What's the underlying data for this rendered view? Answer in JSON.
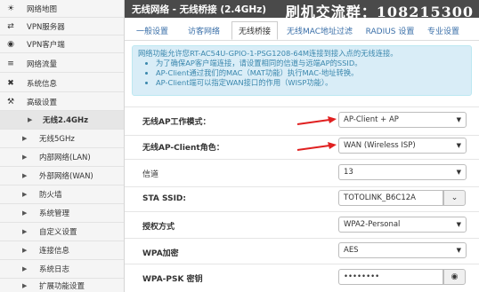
{
  "sidebar": {
    "items": [
      {
        "icon": "globe-icon",
        "glyph": "☀",
        "label": "网络地图"
      },
      {
        "icon": "vpn-server-icon",
        "glyph": "⇄",
        "label": "VPN服务器"
      },
      {
        "icon": "vpn-client-icon",
        "glyph": "◉",
        "label": "VPN客户端"
      },
      {
        "icon": "traffic-icon",
        "glyph": "≡",
        "label": "网络流量"
      },
      {
        "icon": "sysinfo-icon",
        "glyph": "✖",
        "label": "系统信息"
      },
      {
        "icon": "wrench-icon",
        "glyph": "⚒",
        "label": "高级设置"
      }
    ],
    "sub_items": [
      {
        "label": "无线2.4GHz",
        "active": true
      },
      {
        "label": "无线5GHz",
        "active": false
      },
      {
        "label": "内部网络(LAN)",
        "active": false
      },
      {
        "label": "外部网络(WAN)",
        "active": false
      },
      {
        "label": "防火墙",
        "active": false
      },
      {
        "label": "系统管理",
        "active": false
      },
      {
        "label": "自定义设置",
        "active": false
      },
      {
        "label": "连接信息",
        "active": false
      },
      {
        "label": "系统日志",
        "active": false
      },
      {
        "label": "扩展功能设置",
        "active": false
      }
    ]
  },
  "header": {
    "title": "无线网络 - 无线桥接 (2.4GHz)",
    "watermark": "刷机交流群：108215300"
  },
  "tabs": [
    {
      "label": "一般设置",
      "active": false
    },
    {
      "label": "访客网络",
      "active": false
    },
    {
      "label": "无线桥接",
      "active": true
    },
    {
      "label": "无线MAC地址过滤",
      "active": false
    },
    {
      "label": "RADIUS 设置",
      "active": false
    },
    {
      "label": "专业设置",
      "active": false
    }
  ],
  "info": {
    "intro": "网络功能允许您RT-AC54U-GPIO-1-PSG1208-64M连接到接入点的无线连接。",
    "bullets": [
      "为了确保AP客户端连接，请设置相同的信道与远端AP的SSID。",
      "AP-Client通过我们的MAC（MAT功能）执行MAC-地址转换。",
      "AP-Client端可以指定WAN接口的作用（WISP功能）。"
    ]
  },
  "form": {
    "ap_mode_label": "无线AP工作模式：",
    "ap_mode_value": "AP-Client + AP",
    "client_role_label": "无线AP-Client角色：",
    "client_role_value": "WAN (Wireless ISP)",
    "channel_label": "信道",
    "channel_value": "13",
    "ssid_label": "STA SSID:",
    "ssid_value": "TOTOLINK_B6C12A",
    "auth_label": "授权方式",
    "auth_value": "WPA2-Personal",
    "encryption_label": "WPA加密",
    "encryption_value": "AES",
    "psk_label": "WPA-PSK 密钥",
    "psk_value": "••••••••"
  },
  "colors": {
    "header_bg": "#4a4a4a",
    "info_bg": "#d9edf7",
    "info_text": "#3a87ad",
    "annotation_arrow": "#e02020",
    "tab_link": "#3a6fa8"
  }
}
